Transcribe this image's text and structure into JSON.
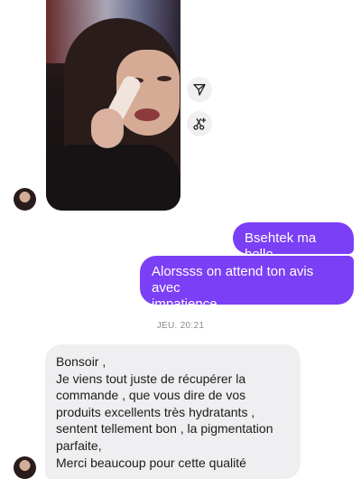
{
  "messages_outgoing": [
    {
      "text": "Bsehtek ma belle"
    },
    {
      "line1": "Alorssss on attend ton avis avec",
      "line2": "impatience"
    }
  ],
  "timestamp": "JEU. 20:21",
  "incoming_message": {
    "lines": [
      "Bonsoir ,",
      "Je viens tout juste de récupérer la",
      "commande , que vous dire de vos",
      "produits excellents très hydratants ,",
      "sentent tellement bon , la pigmentation",
      "parfaite,",
      "Merci beaucoup pour cette qualité"
    ]
  },
  "icons": {
    "share": "send-icon",
    "remix": "scissors-sparkle-icon"
  },
  "colors": {
    "outgoing_bubble": "#7b3ff5",
    "incoming_bubble": "#efeff1"
  }
}
